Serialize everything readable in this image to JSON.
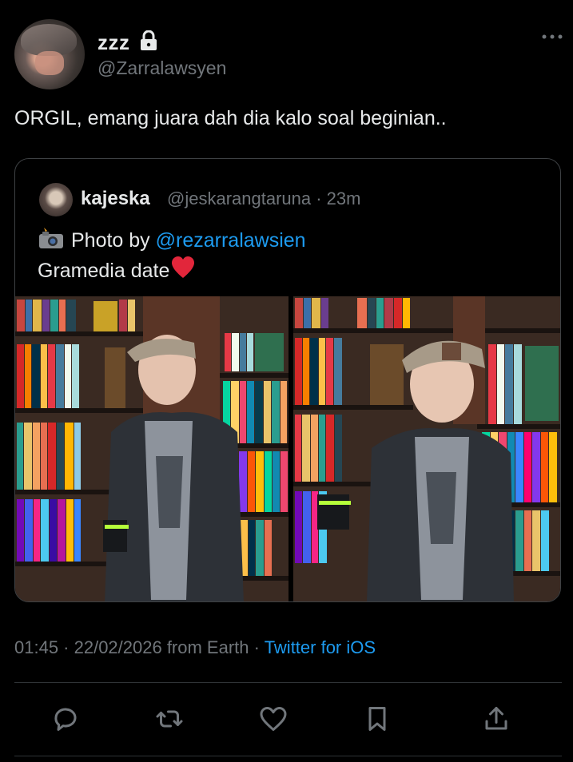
{
  "author": {
    "display_name": "zzz",
    "handle": "@Zarralawsyen"
  },
  "tweet": {
    "text": "ORGIL, emang juara dah dia kalo soal beginian.."
  },
  "quoted": {
    "display_name": "kajeska",
    "handle_time": "@jeskarangtaruna · 23m",
    "line1_prefix": "Photo by ",
    "line1_mention": "@rezarralawsien",
    "line2": "Gramedia date"
  },
  "meta": {
    "time_date": "01:45 · 22/02/2026 from Earth · ",
    "client": "Twitter for iOS"
  },
  "icons": {
    "lock": "lock-icon",
    "more": "more-horizontal-icon",
    "reply": "reply-icon",
    "retweet": "retweet-icon",
    "like": "heart-icon",
    "bookmark": "bookmark-icon",
    "share": "share-icon"
  },
  "colors": {
    "background": "#000000",
    "text": "#e7e9ea",
    "secondary": "#71767b",
    "accent": "#1d9bf0",
    "border": "#3e4144"
  }
}
